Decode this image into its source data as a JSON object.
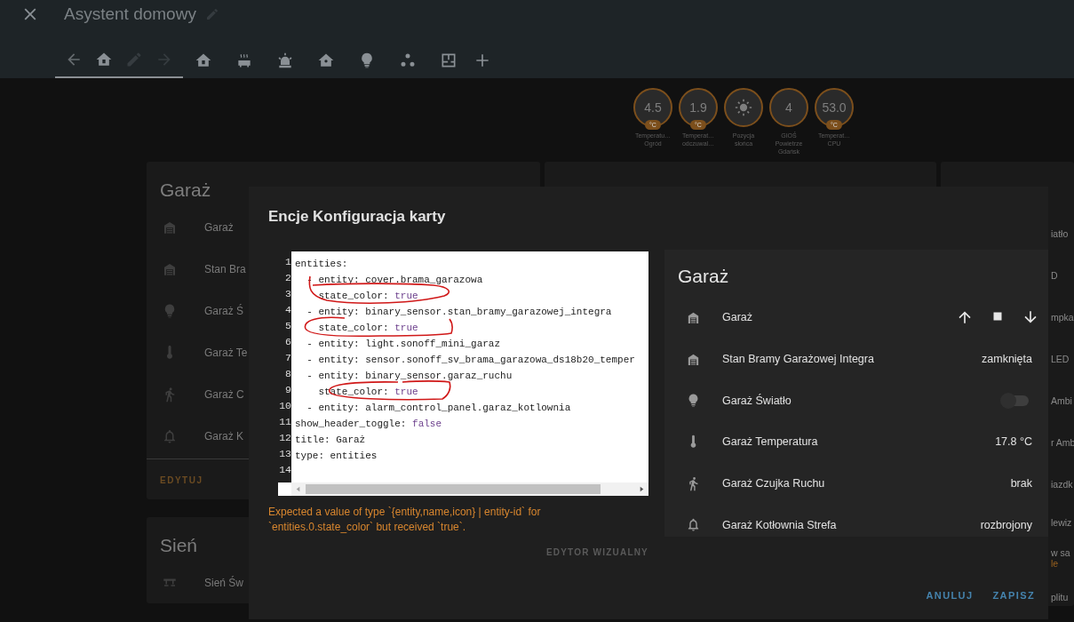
{
  "header": {
    "title": "Asystent domowy",
    "view_tabs": [
      {
        "selected": true
      },
      {
        "selected": false
      },
      {
        "selected": false
      },
      {
        "selected": false
      },
      {
        "selected": false
      },
      {
        "selected": false
      },
      {
        "selected": false
      },
      {
        "selected": false
      }
    ]
  },
  "badges": [
    {
      "kind": "value",
      "value": "4.5",
      "unit": "°C",
      "label": [
        "Temperatu…",
        "Ogród"
      ]
    },
    {
      "kind": "value",
      "value": "1.9",
      "unit": "°C",
      "label": [
        "Temperat…",
        "odczuwal…"
      ]
    },
    {
      "kind": "icon",
      "label": [
        "Pozycja",
        "słońca"
      ]
    },
    {
      "kind": "value",
      "value": "4",
      "label": [
        "GIOŚ",
        "Powietrze",
        "Gdańsk"
      ]
    },
    {
      "kind": "value",
      "value": "53.0",
      "unit": "°C",
      "label": [
        "Temperat…",
        "CPU"
      ]
    }
  ],
  "left_cards": [
    {
      "title": "Garaż",
      "rows": [
        "Garaż",
        "Stan Bra",
        "Garaż Ś",
        "Garaż Te",
        "Garaż C",
        "Garaż K"
      ],
      "action": "EDYTUJ"
    },
    {
      "title": "Sień",
      "rows": [
        "Sień Św"
      ]
    }
  ],
  "right_card": {
    "rows": [
      {
        "name": "iatło"
      },
      {
        "name": "D"
      },
      {
        "name": "mpka"
      },
      {
        "name": "LED"
      },
      {
        "name": "Ambi"
      },
      {
        "name": "r Amb"
      },
      {
        "name": "iazdk"
      },
      {
        "name": "lewiz"
      },
      {
        "name": "w sa",
        "secondary": "le"
      },
      {
        "name": "plitu"
      }
    ]
  },
  "dialog": {
    "title": "Encje Konfiguracja karty",
    "yaml": [
      {
        "n": "1",
        "code": "entities:"
      },
      {
        "n": "2",
        "code": "  - entity: cover.brama_garazowa"
      },
      {
        "n": "3",
        "code": "    state_color: ",
        "literal": "true"
      },
      {
        "n": "4",
        "code": "  - entity: binary_sensor.stan_bramy_garazowej_integra"
      },
      {
        "n": "5",
        "code": "    state_color: ",
        "literal": "true"
      },
      {
        "n": "6",
        "code": "  - entity: light.sonoff_mini_garaz"
      },
      {
        "n": "7",
        "code": "  - entity: sensor.sonoff_sv_brama_garazowa_ds18b20_temper"
      },
      {
        "n": "8",
        "code": "  - entity: binary_sensor.garaz_ruchu"
      },
      {
        "n": "9",
        "code": "    state_color: ",
        "literal": "true"
      },
      {
        "n": "10",
        "code": "  - entity: alarm_control_panel.garaz_kotlownia"
      },
      {
        "n": "11",
        "code": "show_header_toggle: ",
        "literal": "false"
      },
      {
        "n": "12",
        "code": "title: Garaż"
      },
      {
        "n": "13",
        "code": "type: entities"
      },
      {
        "n": "14"
      }
    ],
    "error": "Expected a value of type `{entity,name,icon} | entity-id` for `entities.0.state_color` but received `true`.",
    "visual_editor": "EDYTOR WIZUALNY",
    "preview": {
      "title": "Garaż",
      "rows": [
        {
          "kind": "cover",
          "name": "Garaż"
        },
        {
          "kind": "state",
          "name": "Stan Bramy Garażowej Integra",
          "value": "zamknięta"
        },
        {
          "kind": "toggle",
          "name": "Garaż Światło",
          "on": false
        },
        {
          "kind": "state",
          "name": "Garaż Temperatura",
          "value": "17.8 °C"
        },
        {
          "kind": "state",
          "name": "Garaż Czujka Ruchu",
          "value": "brak"
        },
        {
          "kind": "state",
          "name": "Garaż Kotłownia Strefa",
          "value": "rozbrojony"
        }
      ]
    },
    "buttons": [
      "ANULUJ",
      "ZAPISZ"
    ]
  }
}
